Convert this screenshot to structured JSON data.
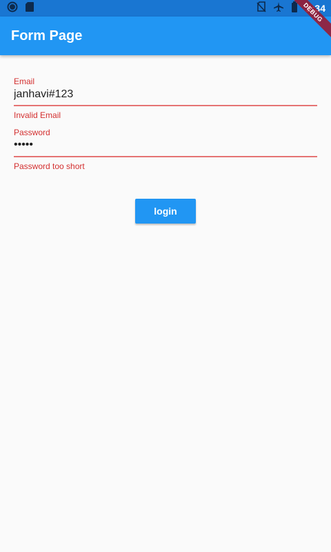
{
  "status_bar": {
    "time": "2:34",
    "left_icons": [
      "circle-icon",
      "sd-card-icon"
    ],
    "right_icons": [
      "no-sim-icon",
      "airplane-icon",
      "battery-icon"
    ]
  },
  "debug_banner": {
    "text": "DEBUG"
  },
  "app_bar": {
    "title": "Form Page"
  },
  "form": {
    "email": {
      "label": "Email",
      "value": "janhavi#123",
      "error": "Invalid Email"
    },
    "password": {
      "label": "Password",
      "value": "•••••",
      "error": "Password too short"
    },
    "login_label": "login"
  },
  "colors": {
    "primary": "#2196f3",
    "status_bar": "#1976d2",
    "error": "#d32f2f",
    "background": "#fafafa"
  }
}
